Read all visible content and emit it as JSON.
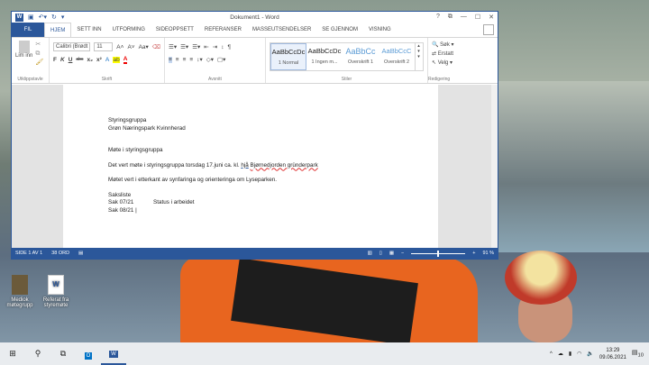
{
  "window": {
    "title": "Dokument1 - Word",
    "help": "?",
    "restore_ribbon": "⧉",
    "minimize": "—",
    "maximize": "☐",
    "close": "✕"
  },
  "tabs": [
    "FIL",
    "HJEM",
    "SETT INN",
    "UTFORMING",
    "SIDEOPPSETT",
    "REFERANSER",
    "MASSEUTSENDELSER",
    "SE GJENNOM",
    "VISNING"
  ],
  "ribbon": {
    "clipboard": {
      "paste": "Lim inn",
      "label": "Utklippstavle"
    },
    "font": {
      "name": "Calibri (Brødt",
      "size": "11",
      "label": "Skrift",
      "bold": "F",
      "italic": "K",
      "underline": "U",
      "strike": "abc"
    },
    "paragraph": {
      "label": "Avsnitt"
    },
    "styles": {
      "label": "Stiler",
      "items": [
        {
          "preview": "AaBbCcDc",
          "name": "1 Normal"
        },
        {
          "preview": "AaBbCcDc",
          "name": "1 Ingen m..."
        },
        {
          "preview": "AaBbCc",
          "name": "Overskrift 1"
        },
        {
          "preview": "AaBbCcC",
          "name": "Overskrift 2"
        }
      ]
    },
    "editing": {
      "label": "Redigering",
      "find": "Søk",
      "replace": "Erstatt",
      "select": "Velg"
    }
  },
  "document": {
    "line1": "Styringsgruppa",
    "line2": "Grøn Næringspark Kvinnherad",
    "heading": "Møte i styringsgruppa",
    "p1a": "Det vert møte i styringsgruppa torsdag 17.juni ca. kl.  ",
    "p1b": "hjå",
    "p1c": "Bjørnedjorden gründerpark",
    "p2": "Møtet vert i etterkant av synfaringa og orienteringa om Lyseparken.",
    "saksliste": "Saksliste",
    "sak1": "Sak 07/21",
    "sak1_title": "Status i arbeidet",
    "sak2": "Sak 08/21 |"
  },
  "status": {
    "page": "SIDE 1 AV 1",
    "words": "38 ORD",
    "zoom": "91 %"
  },
  "desktop": {
    "icons": [
      "Mediok møtegrupp",
      "Referat fra styremøte"
    ]
  },
  "taskbar": {
    "time": "13:29",
    "date": "09.06.2021",
    "notifications": "10"
  }
}
